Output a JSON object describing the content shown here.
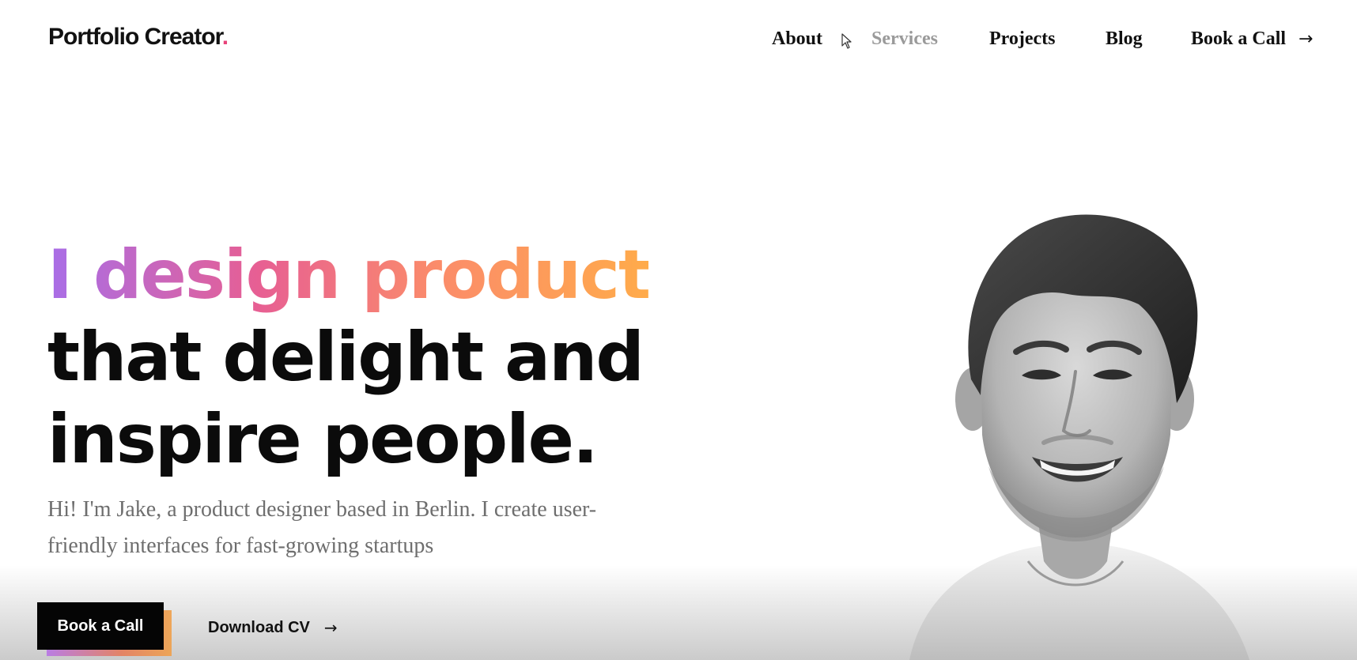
{
  "logo": {
    "text": "Portfolio Creator",
    "dot": "."
  },
  "nav": {
    "about": "About",
    "services": "Services",
    "projects": "Projects",
    "blog": "Blog",
    "book": "Book a Call",
    "book_icon": "arrow-right-icon"
  },
  "hero": {
    "line1": "I design products",
    "line2": "that delight and",
    "line3": "inspire people.",
    "intro": "Hi! I'm Jake, a product designer based in Berlin. I create user-friendly interfaces for fast-growing startups"
  },
  "cta": {
    "primary": "Book a Call",
    "secondary": "Download CV",
    "secondary_icon": "arrow-right-icon"
  },
  "colors": {
    "gradient_start": "#a86ee8",
    "gradient_mid": "#e75f93",
    "gradient_end": "#ffab4a",
    "logo_dot": "#e8437a",
    "muted_nav": "#9a9a9a"
  }
}
